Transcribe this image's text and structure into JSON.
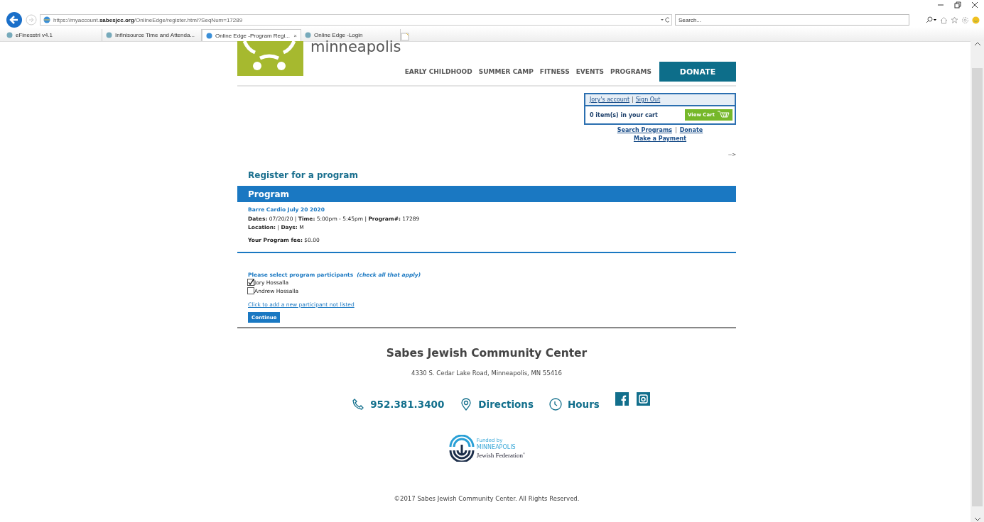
{
  "browser": {
    "address": "https://myaccount.**sabesjcc.org**/OnlineEdge/register.html?SeqNum=17289",
    "search": {
      "placeholder": "Search..."
    },
    "tabs": [
      {
        "label": "eFinesstri v4.1",
        "selected": false
      },
      {
        "label": "Infinisource Time and Attenda...",
        "selected": false
      },
      {
        "label": "Online Edge -Program Regi...",
        "selected": true,
        "close": "×"
      },
      {
        "label": "Online Edge -Login",
        "selected": false
      }
    ]
  },
  "header": {
    "logo_text": "minneapolis",
    "nav": [
      "EARLY CHILDHOOD",
      "SUMMER CAMP",
      "FITNESS",
      "EVENTS",
      "PROGRAMS"
    ],
    "donate": "DONATE"
  },
  "account_box": {
    "line": [
      {
        "kind": "link",
        "text": "Jory's account"
      },
      {
        "kind": "sep",
        "text": "|"
      },
      {
        "kind": "link",
        "text": "Sign Out"
      }
    ],
    "cart_text": "0 item(s) in your cart",
    "view_cart": "View Cart",
    "links": [
      [
        {
          "kind": "link",
          "text": "Search Programs"
        },
        {
          "kind": "sep",
          "text": "|"
        },
        {
          "kind": "link",
          "text": "Donate"
        }
      ],
      [
        {
          "kind": "link",
          "text": "Make a Payment"
        }
      ]
    ],
    "stray": "-->"
  },
  "register": {
    "heading": "Register for a program",
    "panel_title": "Program",
    "program_name": "Barre Cardio July 20 2020",
    "details": [
      "**Dates:** 07/20/20 | **Time:** 5:00pm - 5:45pm | **Program#:** 17289",
      "**Location:** | **Days:** M"
    ],
    "fee": "**Your Program fee:** $0.00",
    "prompt": "Please select program participants",
    "hint": "(check all that apply)",
    "participants": [
      {
        "name": "Jory Hossalla",
        "checked": true
      },
      {
        "name": "Andrew Hossalla",
        "checked": false
      }
    ],
    "add_link": "Click to add a new participant not listed",
    "continue": "Continue"
  },
  "footer": {
    "org": "Sabes Jewish Community Center",
    "address": "4330 S. Cedar Lake Road, Minneapolis, MN 55416",
    "contacts": [
      {
        "kind": "phone",
        "text": "952.381.3400"
      },
      {
        "kind": "directions",
        "text": "Directions"
      },
      {
        "kind": "hours",
        "text": "Hours"
      }
    ],
    "social": [
      {
        "kind": "facebook"
      },
      {
        "kind": "instagram"
      }
    ],
    "federation": {
      "funded": "Funded by",
      "city": "MINNEAPOLIS",
      "name": "Jewish Federation",
      "mark": "®"
    },
    "copyright": "©2017 Sabes Jewish Community Center. All Rights Reserved."
  }
}
